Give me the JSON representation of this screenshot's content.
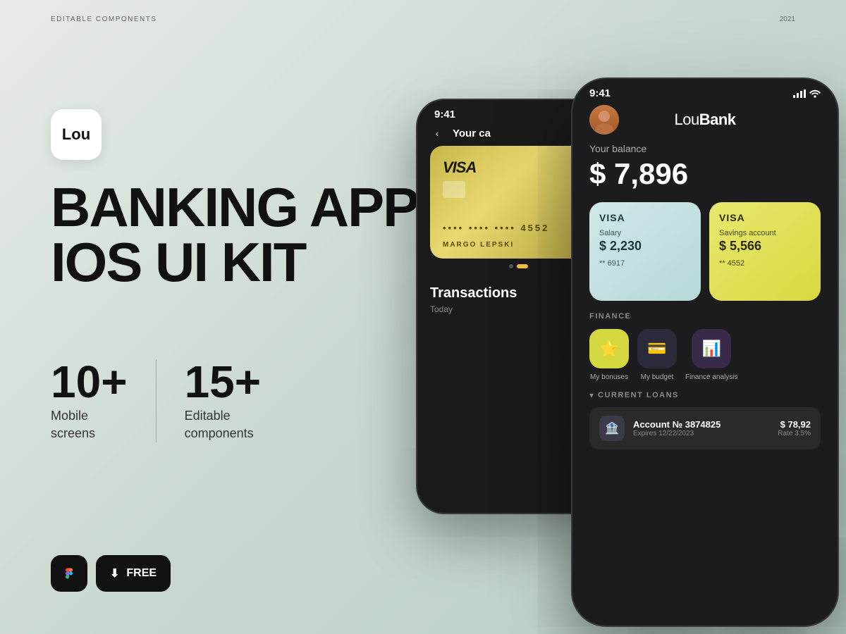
{
  "meta": {
    "top_label_left": "EDITABLE COMPONENTS",
    "top_label_right": "2021"
  },
  "logo": {
    "text": "Lou"
  },
  "heading": {
    "line1": "BANKING APP",
    "line2": "IOS UI KIT"
  },
  "stats": [
    {
      "number": "10+",
      "label_line1": "Mobile",
      "label_line2": "screens"
    },
    {
      "number": "15+",
      "label_line1": "Editable",
      "label_line2": "components"
    }
  ],
  "buttons": {
    "free_label": "FREE"
  },
  "back_phone": {
    "status_time": "9:41",
    "header_label": "Your ca",
    "card": {
      "brand": "VISA",
      "number_masked": "•••• •••• •••• 4552",
      "holder": "MARGO LEPSKI"
    },
    "transactions_title": "Transactions",
    "transactions_sub": "Today"
  },
  "front_phone": {
    "status_time": "9:41",
    "app_name_light": "Lou",
    "app_name_bold": "Bank",
    "balance_label": "Your balance",
    "balance_amount": "$ 7,896",
    "cards": [
      {
        "brand": "VISA",
        "type": "Salary",
        "amount": "$ 2,230",
        "number": "** 6917",
        "style": "light"
      },
      {
        "brand": "VISA",
        "type": "Savings account",
        "amount": "$ 5,566",
        "number": "** 4552",
        "style": "yellow"
      }
    ],
    "finance_section_title": "FINANCE",
    "finance_items": [
      {
        "label": "My bonuses",
        "emoji": "⭐",
        "style": "yellow"
      },
      {
        "label": "My budget",
        "emoji": "💳",
        "style": "dark"
      },
      {
        "label": "Finance analysis",
        "emoji": "📊",
        "style": "purple"
      }
    ],
    "loans_section_title": "CURRENT LOANS",
    "loan": {
      "account": "Account № 3874825",
      "expires": "Expires 12/22/2023",
      "amount": "$ 78,92",
      "rate": "Rate 3.5%"
    }
  }
}
